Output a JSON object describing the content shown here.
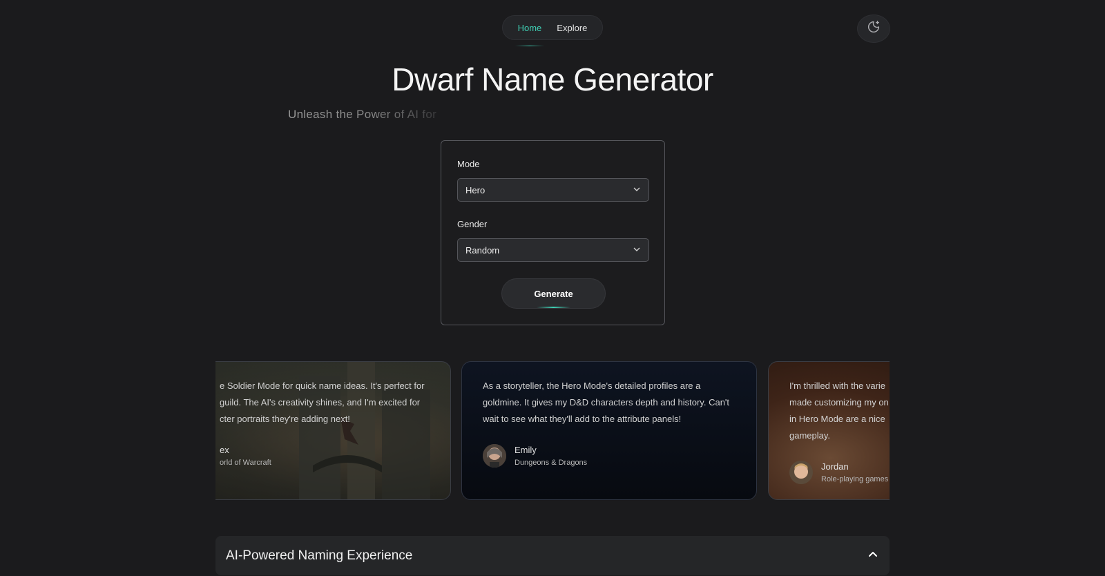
{
  "nav": {
    "items": [
      {
        "label": "Home",
        "active": true
      },
      {
        "label": "Explore",
        "active": false
      }
    ]
  },
  "theme_toggle": {
    "icon": "moon-sparkle-icon"
  },
  "hero": {
    "title": "Dwarf Name Generator",
    "subtitle": "Unleash the Power of AI for"
  },
  "form": {
    "mode": {
      "label": "Mode",
      "value": "Hero"
    },
    "gender": {
      "label": "Gender",
      "value": "Random"
    },
    "generate_label": "Generate"
  },
  "testimonials": [
    {
      "lines": [
        "e Soldier Mode for quick name ideas. It's perfect for",
        "guild. The AI's creativity shines, and I'm excited for",
        "cter portraits they're adding next!"
      ],
      "name": "ex",
      "source": "orld of Warcraft"
    },
    {
      "lines": [
        "As a storyteller, the Hero Mode's detailed profiles are a",
        "goldmine. It gives my D&D characters depth and history. Can't",
        "wait to see what they'll add to the attribute panels!"
      ],
      "name": "Emily",
      "source": "Dungeons & Dragons"
    },
    {
      "lines": [
        "I'm thrilled with the varie",
        "made customizing my on",
        "in Hero Mode are a nice",
        "gameplay."
      ],
      "name": "Jordan",
      "source": "Role-playing games"
    }
  ],
  "accordion": {
    "title": "AI-Powered Naming Experience",
    "expanded": true
  },
  "colors": {
    "accent": "#3fcfb4",
    "background": "#1b1b1d"
  }
}
